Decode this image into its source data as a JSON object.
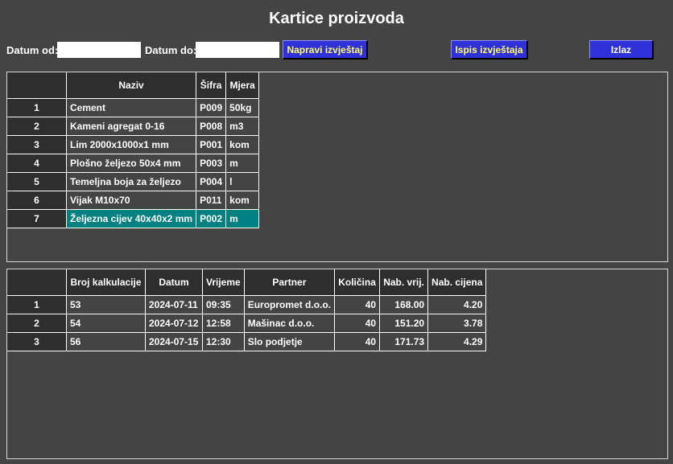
{
  "title": "Kartice proizvoda",
  "toolbar": {
    "date_from_label": "Datum od:",
    "date_from_value": "",
    "date_to_label": "Datum do:",
    "date_to_value": "",
    "make_report_label": "Napravi izvještaj",
    "print_report_label": "Ispis izvještaja",
    "exit_label": "Izlaz"
  },
  "products": {
    "columns": [
      "",
      "Naziv",
      "Šifra",
      "Mjera"
    ],
    "rows": [
      {
        "num": "1",
        "naziv": "Cement",
        "sifra": "P009",
        "mjera": "50kg"
      },
      {
        "num": "2",
        "naziv": "Kameni agregat 0-16",
        "sifra": "P008",
        "mjera": "m3"
      },
      {
        "num": "3",
        "naziv": "Lim 2000x1000x1 mm",
        "sifra": "P001",
        "mjera": "kom"
      },
      {
        "num": "4",
        "naziv": "Plošno željezo 50x4 mm",
        "sifra": "P003",
        "mjera": "m"
      },
      {
        "num": "5",
        "naziv": "Temeljna boja za željezo",
        "sifra": "P004",
        "mjera": "l"
      },
      {
        "num": "6",
        "naziv": "Vijak M10x70",
        "sifra": "P011",
        "mjera": "kom"
      },
      {
        "num": "7",
        "naziv": "Željezna cijev 40x40x2 mm",
        "sifra": "P002",
        "mjera": "m"
      }
    ],
    "selected_row": 7
  },
  "calculations": {
    "columns": [
      "",
      "Broj kalkulacije",
      "Datum",
      "Vrijeme",
      "Partner",
      "Količina",
      "Nab. vrij.",
      "Nab. cijena"
    ],
    "rows": [
      {
        "num": "1",
        "broj": "53",
        "datum": "2024-07-11",
        "vrijeme": "09:35",
        "partner": "Europromet d.o.o.",
        "kolicina": "40",
        "nab_vrij": "168.00",
        "nab_cijena": "4.20"
      },
      {
        "num": "2",
        "broj": "54",
        "datum": "2024-07-12",
        "vrijeme": "12:58",
        "partner": "Mašinac d.o.o.",
        "kolicina": "40",
        "nab_vrij": "151.20",
        "nab_cijena": "3.78"
      },
      {
        "num": "3",
        "broj": "56",
        "datum": "2024-07-15",
        "vrijeme": "12:30",
        "partner": "Slo podjetje",
        "kolicina": "40",
        "nab_vrij": "171.73",
        "nab_cijena": "4.29"
      }
    ]
  },
  "colors": {
    "background": "#444444",
    "header_bg": "#2e2e2e",
    "selected_row": "#008080",
    "button_bg": "#3131d9",
    "button_text": "#ffff66"
  }
}
